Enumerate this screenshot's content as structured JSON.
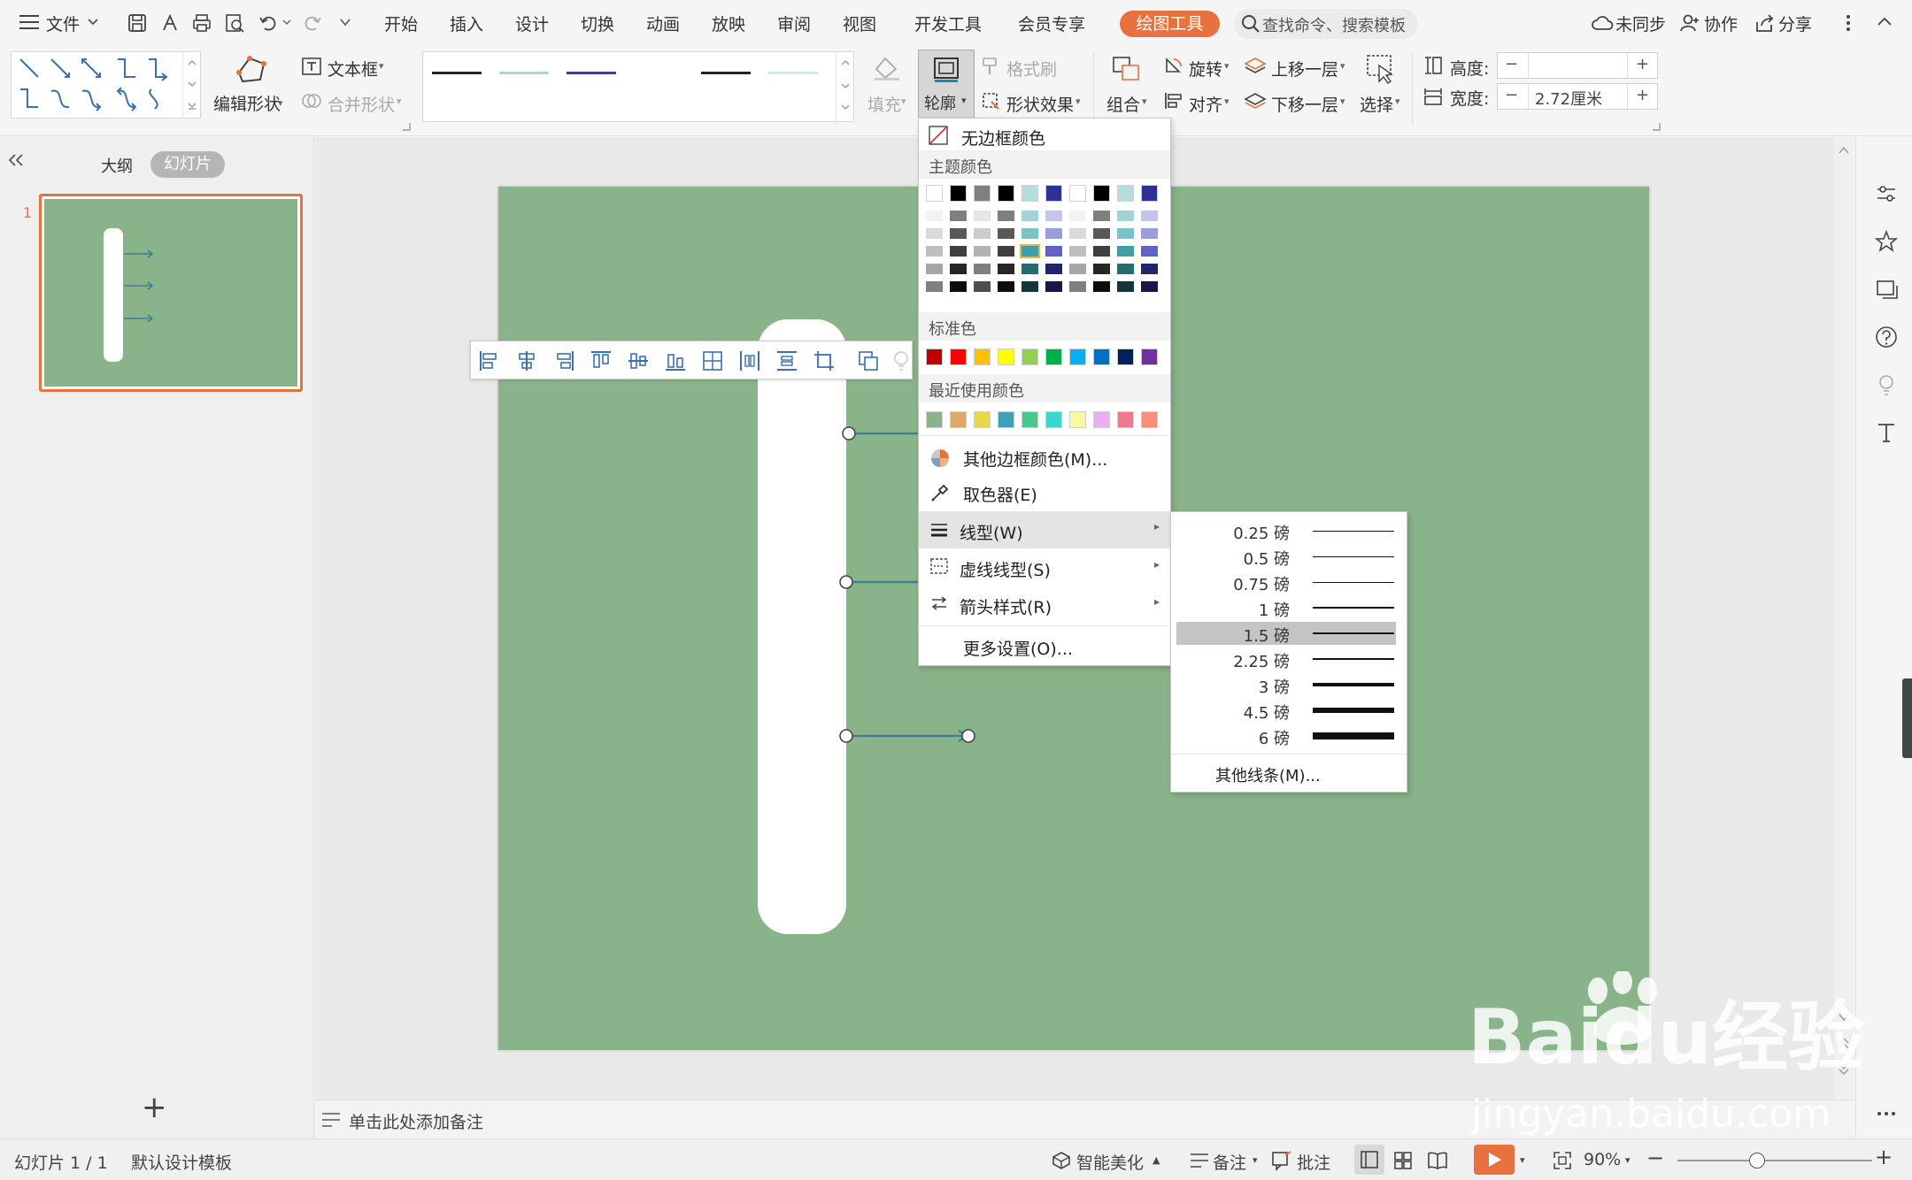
{
  "menubar": {
    "file_label": "文件",
    "tabs": [
      "开始",
      "插入",
      "设计",
      "切换",
      "动画",
      "放映",
      "审阅",
      "视图",
      "开发工具",
      "会员专享"
    ],
    "drawing_tools_tab": "绘图工具",
    "search_placeholder": "查找命令、搜索模板",
    "sync_label": "未同步",
    "collab_label": "协作",
    "share_label": "分享"
  },
  "ribbon": {
    "edit_shape": "编辑形状",
    "textbox": "文本框",
    "merge_shape": "合并形状",
    "fill": "填充",
    "outline": "轮廓",
    "format_painter": "格式刷",
    "shape_effects": "形状效果",
    "group": "组合",
    "rotate": "旋转",
    "align": "对齐",
    "bring_forward": "上移一层",
    "send_backward": "下移一层",
    "select": "选择",
    "height_label": "高度:",
    "height_value": "",
    "width_label": "宽度:",
    "width_value": "2.72厘米",
    "line_style_colors": [
      "#222222",
      "#a8d8dc",
      "#3a3ab0",
      "#ffffff",
      "#222222",
      "#cfeaea"
    ]
  },
  "left_panel": {
    "outline_tab": "大纲",
    "slides_tab": "幻灯片",
    "slide_number": "1",
    "add_slide": "+"
  },
  "outline_menu": {
    "no_border": "无边框颜色",
    "theme_colors_header": "主题颜色",
    "standard_colors_header": "标准色",
    "recent_colors_header": "最近使用颜色",
    "theme_top_row": [
      "#ffffff",
      "#000000",
      "#808080",
      "#000000",
      "#b4dde0",
      "#2e3192",
      "#ffffff",
      "#000000",
      "#b4dde0",
      "#2e3192"
    ],
    "theme_shades": [
      [
        "#f2f2f2",
        "#7f7f7f",
        "#e6e6e6",
        "#7f7f7f",
        "#a3d3d7",
        "#c4c4ec",
        "#f2f2f2",
        "#7f7f7f",
        "#a3d3d7",
        "#c4c4ec"
      ],
      [
        "#d9d9d9",
        "#595959",
        "#cccccc",
        "#595959",
        "#7cc2c8",
        "#9c9ce0",
        "#d9d9d9",
        "#595959",
        "#7cc2c8",
        "#9c9ce0"
      ],
      [
        "#bfbfbf",
        "#3f3f3f",
        "#b3b3b3",
        "#3f3f3f",
        "#3f9ea6",
        "#6161cc",
        "#bfbfbf",
        "#3f3f3f",
        "#3f9ea6",
        "#6161cc"
      ],
      [
        "#a6a6a6",
        "#262626",
        "#808080",
        "#262626",
        "#2a6b70",
        "#22246e",
        "#a6a6a6",
        "#262626",
        "#2a6b70",
        "#22246e"
      ],
      [
        "#7f7f7f",
        "#0d0d0d",
        "#4d4d4d",
        "#0d0d0d",
        "#15363a",
        "#171849",
        "#7f7f7f",
        "#0d0d0d",
        "#15363a",
        "#171849"
      ]
    ],
    "standard_colors": [
      "#c00000",
      "#ff0000",
      "#ffc000",
      "#ffff00",
      "#92d050",
      "#00b050",
      "#00b0f0",
      "#0070c0",
      "#002060",
      "#7030a0"
    ],
    "recent_colors": [
      "#8ab38a",
      "#e0a868",
      "#e8d84a",
      "#3fa0b8",
      "#4ac88a",
      "#38d8d0",
      "#f8f8a0",
      "#e8b0f0",
      "#f07890",
      "#f89078"
    ],
    "other_border_colors": "其他边框颜色(M)...",
    "eyedropper": "取色器(E)",
    "line_style": "线型(W)",
    "dash_style": "虚线线型(S)",
    "arrow_style": "箭头样式(R)",
    "more_settings": "更多设置(O)..."
  },
  "line_weights": {
    "items": [
      {
        "label": "0.25 磅",
        "weight": 0.25
      },
      {
        "label": "0.5 磅",
        "weight": 0.5
      },
      {
        "label": "0.75 磅",
        "weight": 0.75
      },
      {
        "label": "1 磅",
        "weight": 1
      },
      {
        "label": "1.5 磅",
        "weight": 1.5,
        "selected": true
      },
      {
        "label": "2.25 磅",
        "weight": 2.25
      },
      {
        "label": "3 磅",
        "weight": 3
      },
      {
        "label": "4.5 磅",
        "weight": 4.5
      },
      {
        "label": "6 磅",
        "weight": 6
      }
    ],
    "other_lines": "其他线条(M)..."
  },
  "notes_placeholder": "单击此处添加备注",
  "statusbar": {
    "slide_count": "幻灯片 1 / 1",
    "template": "默认设计模板",
    "smart_beautify": "智能美化",
    "notes": "备注",
    "comments": "批注",
    "zoom": "90%"
  },
  "colors": {
    "slide_bg": "#89b389",
    "accent_orange": "#e9703f",
    "connector": "#3a7e98"
  },
  "watermark": {
    "brand": "Baidu经验",
    "url": "jingyan.baidu.com"
  }
}
